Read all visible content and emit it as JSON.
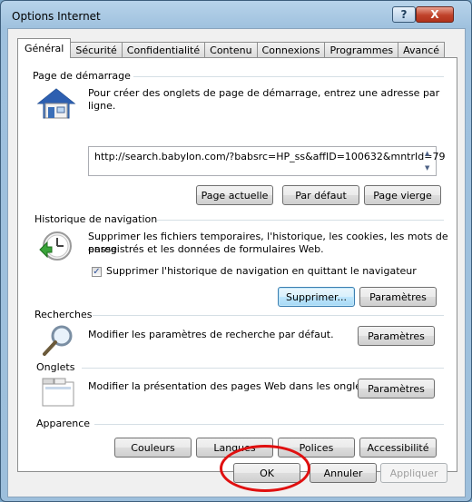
{
  "window": {
    "title": "Options Internet",
    "help_glyph": "?",
    "close_glyph": "X"
  },
  "tabs": [
    {
      "label": "Général"
    },
    {
      "label": "Sécurité"
    },
    {
      "label": "Confidentialité"
    },
    {
      "label": "Contenu"
    },
    {
      "label": "Connexions"
    },
    {
      "label": "Programmes"
    },
    {
      "label": "Avancé"
    }
  ],
  "home": {
    "section_title": "Page de démarrage",
    "description": "Pour créer des onglets de page de démarrage, entrez une adresse par ligne.",
    "url": "http://search.babylon.com/?babsrc=HP_ss&affID=100632&mntrId=79",
    "btn_current": "Page actuelle",
    "btn_default": "Par défaut",
    "btn_blank": "Page vierge",
    "icon": "home-icon"
  },
  "history": {
    "section_title": "Historique de navigation",
    "description_line1": "Supprimer les fichiers temporaires, l'historique, les cookies, les mots de passe",
    "description_line2": "enregistrés et les données de formulaires Web.",
    "checkbox_label": "Supprimer l'historique de navigation en quittant le navigateur",
    "checkbox_checked": true,
    "check_glyph": "✓",
    "btn_delete": "Supprimer...",
    "btn_settings": "Paramètres",
    "icon": "history-clock-icon"
  },
  "search": {
    "section_title": "Recherches",
    "description": "Modifier les paramètres de recherche par défaut.",
    "btn_settings": "Paramètres",
    "icon": "magnifier-icon"
  },
  "tabs_section": {
    "section_title": "Onglets",
    "description": "Modifier la présentation des pages Web dans les onglets.",
    "btn_settings": "Paramètres",
    "icon": "tabs-window-icon"
  },
  "appearance": {
    "section_title": "Apparence",
    "btn_colors": "Couleurs",
    "btn_languages": "Langues",
    "btn_fonts": "Polices",
    "btn_accessibility": "Accessibilité"
  },
  "footer": {
    "btn_ok": "OK",
    "btn_cancel": "Annuler",
    "btn_apply": "Appliquer"
  },
  "colors": {
    "highlight_ellipse": "#e01010",
    "focus_button_border": "#3c7fb1"
  }
}
